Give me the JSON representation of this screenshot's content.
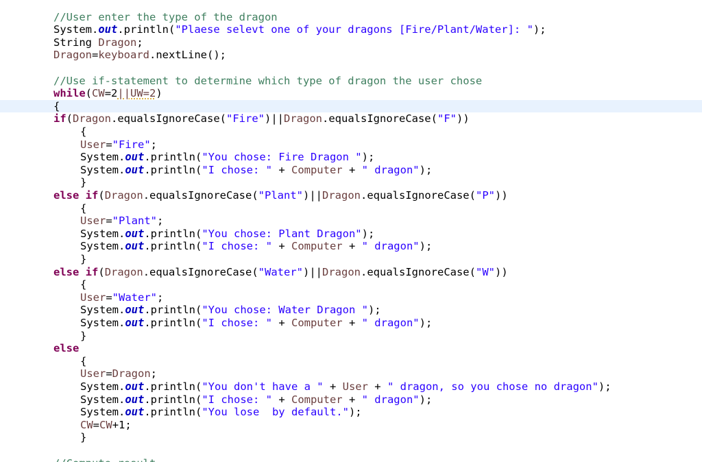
{
  "editor": {
    "colors": {
      "background": "#ffffff",
      "current_line": "#e8f2fe",
      "comment": "#3f7f5f",
      "keyword": "#7f0055",
      "string": "#2a00ff",
      "static_field": "#0000c0",
      "variable": "#6a3e3e",
      "plain": "#000000"
    },
    "current_line_index": 7,
    "lines": [
      {
        "indent": 0,
        "tokens": [
          [
            "c",
            "//User enter the type of the dragon"
          ]
        ]
      },
      {
        "indent": 0,
        "tokens": [
          [
            "p",
            "System."
          ],
          [
            "f",
            "out"
          ],
          [
            "p",
            ".println("
          ],
          [
            "s",
            "\"Plaese selevt one of your dragons [Fire/Plant/Water]: \""
          ],
          [
            "p",
            ");"
          ]
        ]
      },
      {
        "indent": 0,
        "tokens": [
          [
            "p",
            "String "
          ],
          [
            "v",
            "Dragon"
          ],
          [
            "p",
            ";"
          ]
        ]
      },
      {
        "indent": 0,
        "tokens": [
          [
            "v",
            "Dragon"
          ],
          [
            "p",
            "="
          ],
          [
            "v",
            "keyboard"
          ],
          [
            "p",
            ".nextLine();"
          ]
        ]
      },
      {
        "indent": 0,
        "tokens": []
      },
      {
        "indent": 0,
        "tokens": [
          [
            "c",
            "//Use if-statement to determine which type of dragon the user chose"
          ]
        ]
      },
      {
        "indent": 0,
        "tokens": [
          [
            "k",
            "while"
          ],
          [
            "p",
            "("
          ],
          [
            "v",
            "CW"
          ],
          [
            "p",
            "=2"
          ],
          [
            "w",
            "||UW=2"
          ],
          [
            "p",
            ")"
          ]
        ]
      },
      {
        "indent": 0,
        "tokens": [
          [
            "p",
            "{"
          ]
        ]
      },
      {
        "indent": 0,
        "tokens": [
          [
            "k",
            "if"
          ],
          [
            "p",
            "("
          ],
          [
            "v",
            "Dragon"
          ],
          [
            "p",
            ".equalsIgnoreCase("
          ],
          [
            "s",
            "\"Fire\""
          ],
          [
            "p",
            ")||"
          ],
          [
            "v",
            "Dragon"
          ],
          [
            "p",
            ".equalsIgnoreCase("
          ],
          [
            "s",
            "\"F\""
          ],
          [
            "p",
            "))"
          ]
        ]
      },
      {
        "indent": 1,
        "tokens": [
          [
            "p",
            "{"
          ]
        ]
      },
      {
        "indent": 1,
        "tokens": [
          [
            "v",
            "User"
          ],
          [
            "p",
            "="
          ],
          [
            "s",
            "\"Fire\""
          ],
          [
            "p",
            ";"
          ]
        ]
      },
      {
        "indent": 1,
        "tokens": [
          [
            "p",
            "System."
          ],
          [
            "f",
            "out"
          ],
          [
            "p",
            ".println("
          ],
          [
            "s",
            "\"You chose: Fire Dragon \""
          ],
          [
            "p",
            ");"
          ]
        ]
      },
      {
        "indent": 1,
        "tokens": [
          [
            "p",
            "System."
          ],
          [
            "f",
            "out"
          ],
          [
            "p",
            ".println("
          ],
          [
            "s",
            "\"I chose: \""
          ],
          [
            "p",
            " + "
          ],
          [
            "v",
            "Computer"
          ],
          [
            "p",
            " + "
          ],
          [
            "s",
            "\" dragon\""
          ],
          [
            "p",
            ");"
          ]
        ]
      },
      {
        "indent": 1,
        "tokens": [
          [
            "p",
            "}"
          ]
        ]
      },
      {
        "indent": 0,
        "tokens": [
          [
            "k",
            "else"
          ],
          [
            "p",
            " "
          ],
          [
            "k",
            "if"
          ],
          [
            "p",
            "("
          ],
          [
            "v",
            "Dragon"
          ],
          [
            "p",
            ".equalsIgnoreCase("
          ],
          [
            "s",
            "\"Plant\""
          ],
          [
            "p",
            ")||"
          ],
          [
            "v",
            "Dragon"
          ],
          [
            "p",
            ".equalsIgnoreCase("
          ],
          [
            "s",
            "\"P\""
          ],
          [
            "p",
            "))"
          ]
        ]
      },
      {
        "indent": 1,
        "tokens": [
          [
            "p",
            "{"
          ]
        ]
      },
      {
        "indent": 1,
        "tokens": [
          [
            "v",
            "User"
          ],
          [
            "p",
            "="
          ],
          [
            "s",
            "\"Plant\""
          ],
          [
            "p",
            ";"
          ]
        ]
      },
      {
        "indent": 1,
        "tokens": [
          [
            "p",
            "System."
          ],
          [
            "f",
            "out"
          ],
          [
            "p",
            ".println("
          ],
          [
            "s",
            "\"You chose: Plant Dragon\""
          ],
          [
            "p",
            ");"
          ]
        ]
      },
      {
        "indent": 1,
        "tokens": [
          [
            "p",
            "System."
          ],
          [
            "f",
            "out"
          ],
          [
            "p",
            ".println("
          ],
          [
            "s",
            "\"I chose: \""
          ],
          [
            "p",
            " + "
          ],
          [
            "v",
            "Computer"
          ],
          [
            "p",
            " + "
          ],
          [
            "s",
            "\" dragon\""
          ],
          [
            "p",
            ");"
          ]
        ]
      },
      {
        "indent": 1,
        "tokens": [
          [
            "p",
            "}"
          ]
        ]
      },
      {
        "indent": 0,
        "tokens": [
          [
            "k",
            "else"
          ],
          [
            "p",
            " "
          ],
          [
            "k",
            "if"
          ],
          [
            "p",
            "("
          ],
          [
            "v",
            "Dragon"
          ],
          [
            "p",
            ".equalsIgnoreCase("
          ],
          [
            "s",
            "\"Water\""
          ],
          [
            "p",
            ")||"
          ],
          [
            "v",
            "Dragon"
          ],
          [
            "p",
            ".equalsIgnoreCase("
          ],
          [
            "s",
            "\"W\""
          ],
          [
            "p",
            "))"
          ]
        ]
      },
      {
        "indent": 1,
        "tokens": [
          [
            "p",
            "{"
          ]
        ]
      },
      {
        "indent": 1,
        "tokens": [
          [
            "v",
            "User"
          ],
          [
            "p",
            "="
          ],
          [
            "s",
            "\"Water\""
          ],
          [
            "p",
            ";"
          ]
        ]
      },
      {
        "indent": 1,
        "tokens": [
          [
            "p",
            "System."
          ],
          [
            "f",
            "out"
          ],
          [
            "p",
            ".println("
          ],
          [
            "s",
            "\"You chose: Water Dragon \""
          ],
          [
            "p",
            ");"
          ]
        ]
      },
      {
        "indent": 1,
        "tokens": [
          [
            "p",
            "System."
          ],
          [
            "f",
            "out"
          ],
          [
            "p",
            ".println("
          ],
          [
            "s",
            "\"I chose: \""
          ],
          [
            "p",
            " + "
          ],
          [
            "v",
            "Computer"
          ],
          [
            "p",
            " + "
          ],
          [
            "s",
            "\" dragon\""
          ],
          [
            "p",
            ");"
          ]
        ]
      },
      {
        "indent": 1,
        "tokens": [
          [
            "p",
            "}"
          ]
        ]
      },
      {
        "indent": 0,
        "tokens": [
          [
            "k",
            "else"
          ]
        ]
      },
      {
        "indent": 1,
        "tokens": [
          [
            "p",
            "{"
          ]
        ]
      },
      {
        "indent": 1,
        "tokens": [
          [
            "v",
            "User"
          ],
          [
            "p",
            "="
          ],
          [
            "v",
            "Dragon"
          ],
          [
            "p",
            ";"
          ]
        ]
      },
      {
        "indent": 1,
        "tokens": [
          [
            "p",
            "System."
          ],
          [
            "f",
            "out"
          ],
          [
            "p",
            ".println("
          ],
          [
            "s",
            "\"You don't have a \""
          ],
          [
            "p",
            " + "
          ],
          [
            "v",
            "User"
          ],
          [
            "p",
            " + "
          ],
          [
            "s",
            "\" dragon, so you chose no dragon\""
          ],
          [
            "p",
            ");"
          ]
        ]
      },
      {
        "indent": 1,
        "tokens": [
          [
            "p",
            "System."
          ],
          [
            "f",
            "out"
          ],
          [
            "p",
            ".println("
          ],
          [
            "s",
            "\"I chose: \""
          ],
          [
            "p",
            " + "
          ],
          [
            "v",
            "Computer"
          ],
          [
            "p",
            " + "
          ],
          [
            "s",
            "\" dragon\""
          ],
          [
            "p",
            ");"
          ]
        ]
      },
      {
        "indent": 1,
        "tokens": [
          [
            "p",
            "System."
          ],
          [
            "f",
            "out"
          ],
          [
            "p",
            ".println("
          ],
          [
            "s",
            "\"You lose  by default.\""
          ],
          [
            "p",
            ");"
          ]
        ]
      },
      {
        "indent": 1,
        "tokens": [
          [
            "v",
            "CW"
          ],
          [
            "p",
            "="
          ],
          [
            "v",
            "CW"
          ],
          [
            "p",
            "+1;"
          ]
        ]
      },
      {
        "indent": 1,
        "tokens": [
          [
            "p",
            "}"
          ]
        ]
      },
      {
        "indent": 0,
        "tokens": []
      },
      {
        "indent": 0,
        "tokens": [
          [
            "c",
            "//Compute result"
          ]
        ]
      }
    ]
  }
}
